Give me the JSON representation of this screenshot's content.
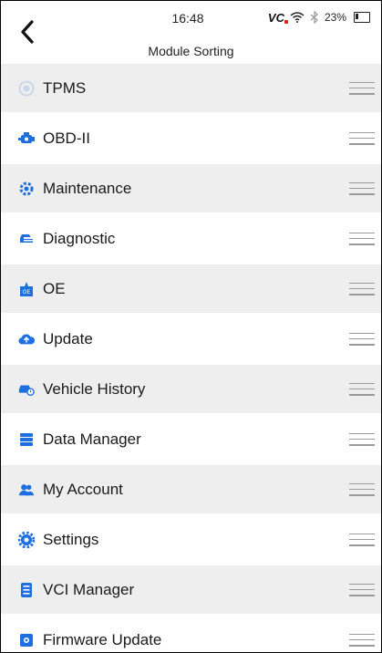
{
  "status_bar": {
    "time": "16:48",
    "vci": "VC",
    "battery": "23%",
    "icons": [
      "vci-icon",
      "wifi-icon",
      "bluetooth-icon",
      "battery-icon"
    ]
  },
  "header": {
    "title": "Module Sorting",
    "back_icon": "chevron-left-icon"
  },
  "modules": [
    {
      "label": "TPMS",
      "icon": "tpms-icon",
      "icon_color": "#c9d7ea"
    },
    {
      "label": "OBD-II",
      "icon": "engine-icon",
      "icon_color": "#1e6fe0"
    },
    {
      "label": "Maintenance",
      "icon": "wrench-gear-icon",
      "icon_color": "#1e6fe0"
    },
    {
      "label": "Diagnostic",
      "icon": "car-diagnostic-icon",
      "icon_color": "#1e6fe0"
    },
    {
      "label": "OE",
      "icon": "oe-icon",
      "icon_color": "#1e6fe0"
    },
    {
      "label": "Update",
      "icon": "cloud-upload-icon",
      "icon_color": "#1e6fe0"
    },
    {
      "label": "Vehicle History",
      "icon": "vehicle-history-icon",
      "icon_color": "#1e6fe0"
    },
    {
      "label": "Data Manager",
      "icon": "data-manager-icon",
      "icon_color": "#1e6fe0"
    },
    {
      "label": "My Account",
      "icon": "account-icon",
      "icon_color": "#1e6fe0"
    },
    {
      "label": "Settings",
      "icon": "gear-icon",
      "icon_color": "#1e6fe0"
    },
    {
      "label": "VCI Manager",
      "icon": "vci-manager-icon",
      "icon_color": "#1e6fe0"
    },
    {
      "label": "Firmware Update",
      "icon": "firmware-update-icon",
      "icon_color": "#1e6fe0"
    }
  ]
}
